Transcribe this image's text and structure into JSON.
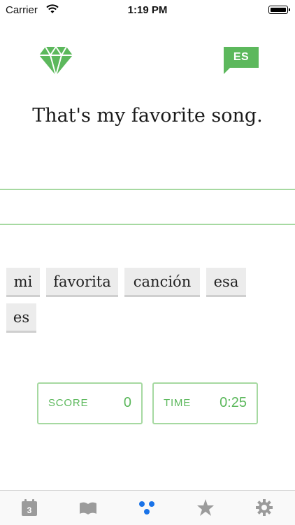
{
  "status_bar": {
    "carrier": "Carrier",
    "time": "1:19 PM"
  },
  "language_badge": {
    "label": "ES"
  },
  "prompt": {
    "sentence": "That's my favorite song."
  },
  "word_bank": {
    "words": [
      "mi",
      "favorita",
      "canción",
      "esa",
      "es"
    ]
  },
  "stats": {
    "score_label": "SCORE",
    "score_value": "0",
    "time_label": "TIME",
    "time_value": "0:25"
  },
  "tab_bar": {
    "calendar_day": "3",
    "active_tab": "practice",
    "tabs": [
      "calendar-icon",
      "book-icon",
      "practice-dots-icon",
      "star-icon",
      "gear-icon"
    ]
  },
  "colors": {
    "accent_green": "#5cb85c",
    "line_green": "#a6d9a1",
    "active_tab_blue": "#1a73e8",
    "inactive_tab_gray": "#9b9b9b"
  }
}
